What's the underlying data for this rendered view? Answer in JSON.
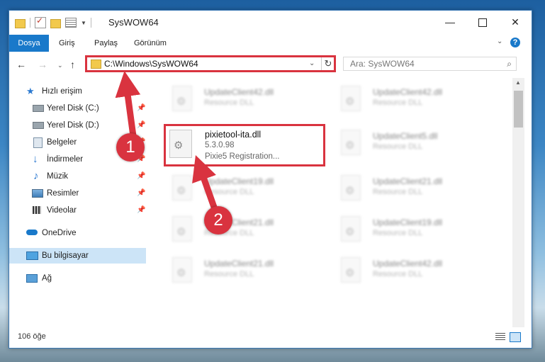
{
  "window": {
    "title": "SysWOW64",
    "controls": {
      "minimize": "—",
      "maximize": "",
      "close": "✕"
    }
  },
  "ribbon": {
    "tabs": [
      "Dosya",
      "Giriş",
      "Paylaş",
      "Görünüm"
    ],
    "help": "?"
  },
  "nav": {
    "back": "←",
    "forward": "→",
    "recent": "⌄",
    "up": "↑",
    "address": "C:\\Windows\\SysWOW64",
    "refresh": "↻",
    "search_placeholder": "Ara: SysWOW64",
    "search_icon": "⌕"
  },
  "sidebar": {
    "items": [
      {
        "label": "Hızlı erişim",
        "icon": "star-icon",
        "pinned": false
      },
      {
        "label": "Yerel Disk (C:)",
        "icon": "drive-icon",
        "pinned": true
      },
      {
        "label": "Yerel Disk (D:)",
        "icon": "drive-icon",
        "pinned": true
      },
      {
        "label": "Belgeler",
        "icon": "documents-icon",
        "pinned": true
      },
      {
        "label": "İndirmeler",
        "icon": "download-icon",
        "pinned": true
      },
      {
        "label": "Müzik",
        "icon": "music-icon",
        "pinned": true
      },
      {
        "label": "Resimler",
        "icon": "pictures-icon",
        "pinned": true
      },
      {
        "label": "Videolar",
        "icon": "videos-icon",
        "pinned": true
      },
      {
        "label": "OneDrive",
        "icon": "cloud-icon",
        "pinned": false
      },
      {
        "label": "Bu bilgisayar",
        "icon": "computer-icon",
        "pinned": false
      },
      {
        "label": "Ağ",
        "icon": "network-icon",
        "pinned": false
      }
    ],
    "pin_glyph": "📌"
  },
  "files": [
    {
      "name": "UpdateClient42.dll",
      "desc": "Resource DLL"
    },
    {
      "name": "UpdateClient42.dll",
      "desc": "Resource DLL"
    },
    {
      "name": "UpdateClient5.dll",
      "desc": "Resource DLL"
    },
    {
      "name": "UpdateClient19.dll",
      "desc": "Resource DLL"
    },
    {
      "name": "UpdateClient21.dll",
      "desc": "Resource DLL"
    },
    {
      "name": "UpdateClient21.dll",
      "desc": "Resource DLL"
    },
    {
      "name": "UpdateClient19.dll",
      "desc": "Resource DLL"
    },
    {
      "name": "UpdateClient21.dll",
      "desc": "Resource DLL"
    },
    {
      "name": "UpdateClient42.dll",
      "desc": "Resource DLL"
    }
  ],
  "highlighted_file": {
    "name": "pixietool-ita.dll",
    "version": "5.3.0.98",
    "desc": "Pixie5 Registration..."
  },
  "status": {
    "item_count": "106 öğe"
  },
  "annotations": {
    "step1": "1",
    "step2": "2",
    "color": "#d9333f"
  }
}
